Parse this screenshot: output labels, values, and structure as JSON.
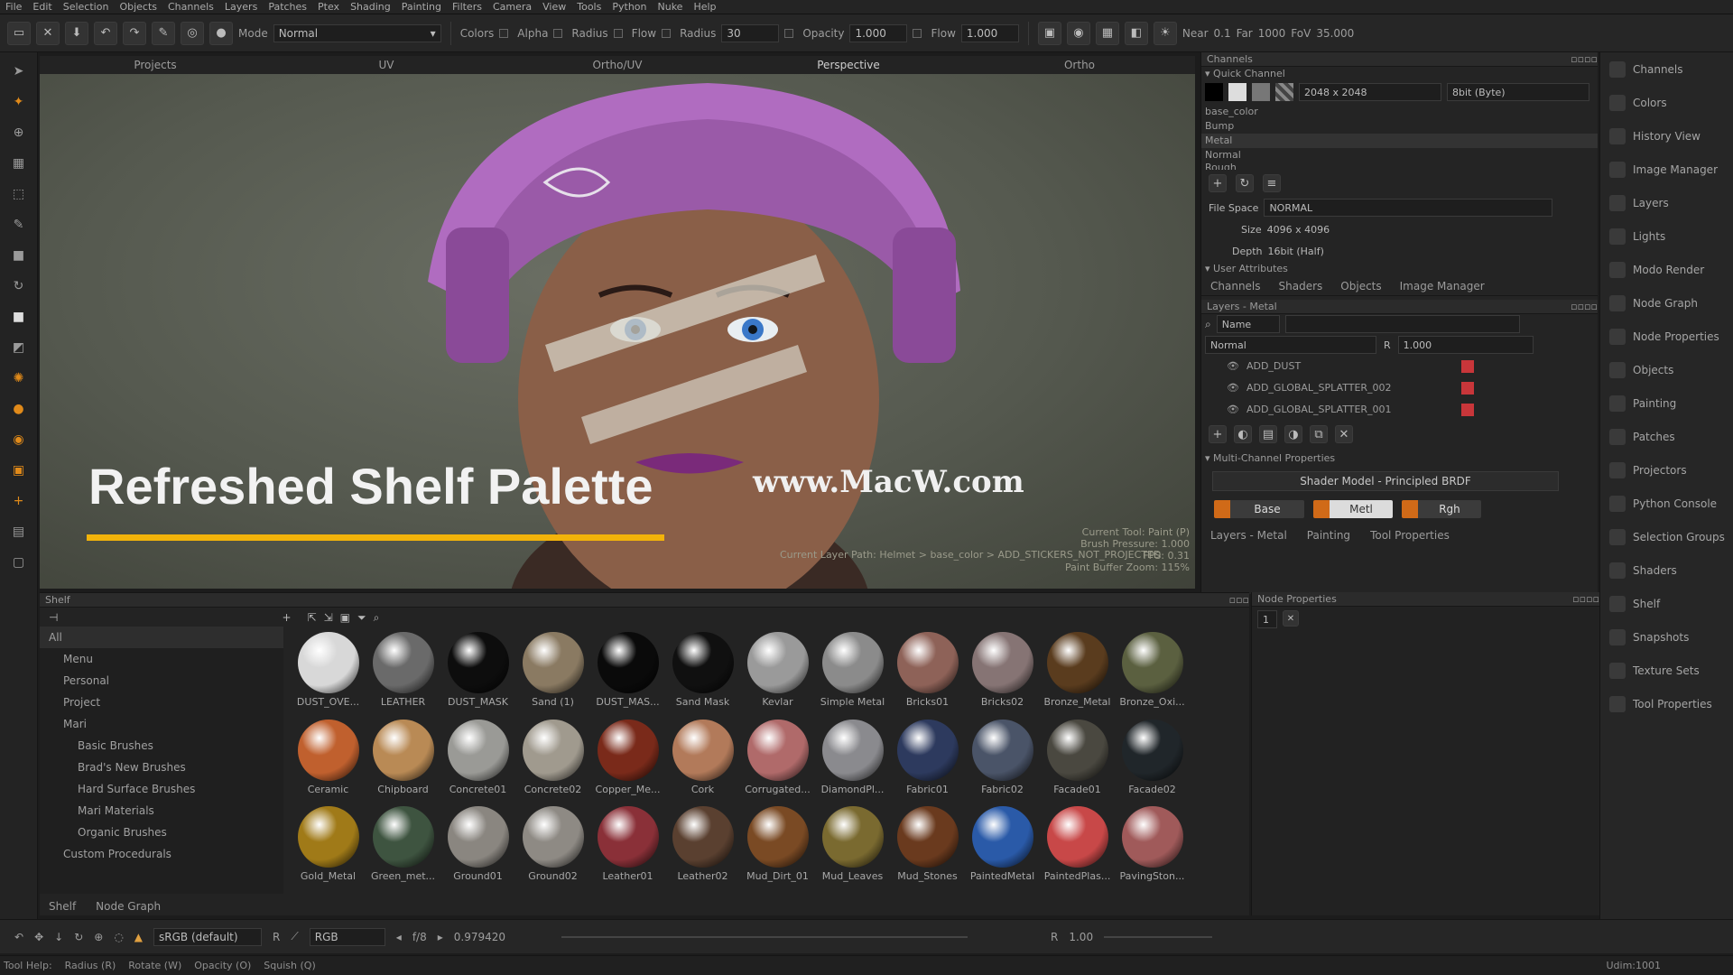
{
  "menu": [
    "File",
    "Edit",
    "Selection",
    "Objects",
    "Channels",
    "Layers",
    "Patches",
    "Ptex",
    "Shading",
    "Painting",
    "Filters",
    "Camera",
    "View",
    "Tools",
    "Python",
    "Nuke",
    "Help"
  ],
  "toolbar": {
    "mode_label": "Mode",
    "mode_value": "Normal",
    "colors": "Colors",
    "alpha": "Alpha",
    "radius": "Radius",
    "flow": "Flow",
    "radius2_label": "Radius",
    "radius2_value": "30",
    "opacity_label": "Opacity",
    "opacity_value": "1.000",
    "flow_label": "Flow",
    "flow_value": "1.000",
    "near_label": "Near",
    "near_value": "0.1",
    "far_label": "Far",
    "far_value": "1000",
    "fov_label": "FoV",
    "fov_value": "35.000"
  },
  "viewport": {
    "tabs": [
      "Projects",
      "UV",
      "Ortho/UV",
      "Perspective",
      "Ortho"
    ],
    "overlay_title": "Refreshed Shelf Palette",
    "overlay_url": "www.MacW.com",
    "hud_lines": [
      "Current Tool: Paint (P)",
      "Brush Pressure: 1.000",
      "FPS: 0.31",
      "Paint Buffer Zoom: 115%"
    ],
    "layer_path": "Current Layer Path: Helmet > base_color > ADD_STICKERS_NOT_PROJECTED"
  },
  "channels": {
    "title": "Channels",
    "quick": "Quick Channel",
    "res": "2048 x 2048",
    "depth_sel": "8bit (Byte)",
    "list": [
      "base_color",
      "Bump",
      "Metal",
      "Normal",
      "Rough"
    ],
    "file_space_label": "File Space",
    "file_space_value": "NORMAL",
    "size_label": "Size",
    "size_value": "4096 x 4096",
    "depth_label": "Depth",
    "depth_value": "16bit (Half)",
    "user_attrs": "User Attributes",
    "tabs": [
      "Channels",
      "Shaders",
      "Objects",
      "Image Manager"
    ]
  },
  "layers": {
    "title": "Layers - Metal",
    "filter": "Name",
    "blend": "Normal",
    "opacity_label": "R",
    "opacity": "1.000",
    "items": [
      "ADD_DUST",
      "ADD_GLOBAL_SPLATTER_002",
      "ADD_GLOBAL_SPLATTER_001"
    ],
    "mcp": "Multi-Channel Properties",
    "shader_model": "Shader Model - Principled BRDF",
    "buttons": [
      "Base",
      "Metl",
      "Rgh"
    ],
    "tabs": [
      "Layers - Metal",
      "Painting",
      "Tool Properties"
    ]
  },
  "dock": [
    "Channels",
    "Colors",
    "History View",
    "Image Manager",
    "Layers",
    "Lights",
    "Modo Render",
    "Node Graph",
    "Node Properties",
    "Objects",
    "Painting",
    "Patches",
    "Projectors",
    "Python Console",
    "Selection Groups",
    "Shaders",
    "Shelf",
    "Snapshots",
    "Texture Sets",
    "Tool Properties"
  ],
  "shelf": {
    "title": "Shelf",
    "tree": [
      {
        "label": "All",
        "level": 0
      },
      {
        "label": "Menu",
        "level": 1
      },
      {
        "label": "Personal",
        "level": 1
      },
      {
        "label": "Project",
        "level": 1
      },
      {
        "label": "Mari",
        "level": 1
      },
      {
        "label": "Basic Brushes",
        "level": 2
      },
      {
        "label": "Brad's New Brushes",
        "level": 2
      },
      {
        "label": "Hard Surface Brushes",
        "level": 2
      },
      {
        "label": "Mari Materials",
        "level": 2
      },
      {
        "label": "Organic Brushes",
        "level": 2
      },
      {
        "label": "Custom Procedurals",
        "level": 1
      }
    ],
    "tabs": [
      "Shelf",
      "Node Graph"
    ],
    "items": [
      {
        "label": "DUST_OVE...",
        "color": "#d8d8d8"
      },
      {
        "label": "LEATHER",
        "color": "#6a6a6a"
      },
      {
        "label": "DUST_MASK",
        "color": "#0d0d0d"
      },
      {
        "label": "Sand (1)",
        "color": "#8a7a62"
      },
      {
        "label": "DUST_MAS...",
        "color": "#0a0a0a"
      },
      {
        "label": "Sand Mask",
        "color": "#101010"
      },
      {
        "label": "Kevlar",
        "color": "#9a9a9a"
      },
      {
        "label": "Simple Metal",
        "color": "#8b8b8b"
      },
      {
        "label": "Bricks01",
        "color": "#8e6258"
      },
      {
        "label": "Bricks02",
        "color": "#867474"
      },
      {
        "label": "Bronze_Metal",
        "color": "#5a3c1e"
      },
      {
        "label": "Bronze_Oxi...",
        "color": "#5b6040"
      },
      {
        "label": "Ceramic",
        "color": "#c0602e"
      },
      {
        "label": "Chipboard",
        "color": "#b98a55"
      },
      {
        "label": "Concrete01",
        "color": "#9a9a96"
      },
      {
        "label": "Concrete02",
        "color": "#a09a8e"
      },
      {
        "label": "Copper_Me...",
        "color": "#7a2a1a"
      },
      {
        "label": "Cork",
        "color": "#b27a5a"
      },
      {
        "label": "Corrugated...",
        "color": "#b06a6a"
      },
      {
        "label": "DiamondPl...",
        "color": "#8a8a8e"
      },
      {
        "label": "Fabric01",
        "color": "#2d3a5e"
      },
      {
        "label": "Fabric02",
        "color": "#4a5468"
      },
      {
        "label": "Facade01",
        "color": "#4a4840"
      },
      {
        "label": "Facade02",
        "color": "#20262a"
      },
      {
        "label": "Gold_Metal",
        "color": "#a07a18"
      },
      {
        "label": "Green_met...",
        "color": "#3e5440"
      },
      {
        "label": "Ground01",
        "color": "#8a8680"
      },
      {
        "label": "Ground02",
        "color": "#8e8a84"
      },
      {
        "label": "Leather01",
        "color": "#8a3038"
      },
      {
        "label": "Leather02",
        "color": "#5a4030"
      },
      {
        "label": "Mud_Dirt_01",
        "color": "#7a4a24"
      },
      {
        "label": "Mud_Leaves",
        "color": "#7a6a30"
      },
      {
        "label": "Mud_Stones",
        "color": "#6a3a1e"
      },
      {
        "label": "PaintedMetal",
        "color": "#2a5aa8"
      },
      {
        "label": "PaintedPlas...",
        "color": "#c84848"
      },
      {
        "label": "PavingSton...",
        "color": "#a05a5a"
      }
    ]
  },
  "nodeprops": {
    "title": "Node Properties",
    "field": "1"
  },
  "bottom": {
    "colorspace": "sRGB (default)",
    "r": "R",
    "channel": "RGB",
    "fstop": "f/8",
    "value": "0.979420",
    "r2": "R",
    "gain": "1.00"
  },
  "status": {
    "help": "Tool Help:",
    "items": [
      "Radius (R)",
      "Rotate (W)",
      "Opacity (O)",
      "Squish (Q)"
    ],
    "udim": "Udim:1001"
  }
}
